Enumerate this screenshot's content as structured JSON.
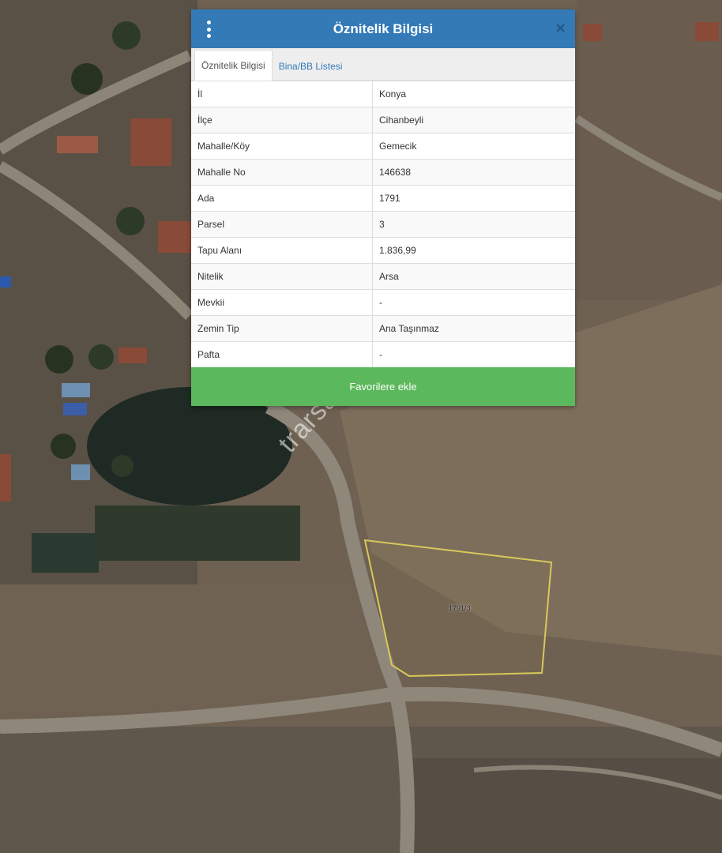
{
  "panel": {
    "title": "Öznitelik Bilgisi",
    "close_glyph": "×",
    "tabs": [
      {
        "label": "Öznitelik Bilgisi",
        "active": true
      },
      {
        "label": "Bina/BB Listesi",
        "active": false
      }
    ],
    "rows": [
      {
        "key": "İl",
        "value": "Konya"
      },
      {
        "key": "İlçe",
        "value": "Cihanbeyli"
      },
      {
        "key": "Mahalle/Köy",
        "value": "Gemecik"
      },
      {
        "key": "Mahalle No",
        "value": "146638"
      },
      {
        "key": "Ada",
        "value": "1791"
      },
      {
        "key": "Parsel",
        "value": "3"
      },
      {
        "key": "Tapu Alanı",
        "value": "1.836,99"
      },
      {
        "key": "Nitelik",
        "value": "Arsa"
      },
      {
        "key": "Mevkii",
        "value": "-"
      },
      {
        "key": "Zemin Tip",
        "value": "Ana Taşınmaz"
      },
      {
        "key": "Pafta",
        "value": "-"
      }
    ],
    "favorite_label": "Favorilere ekle"
  },
  "map": {
    "parcel_label": "1791/3",
    "watermark": "trarsa.com.tr"
  },
  "colors": {
    "header": "#337ab7",
    "favorite": "#5cb85c",
    "parcel_outline": "#d8c85a"
  },
  "icons": {
    "menu": "vertical-dots-icon",
    "close": "close-icon"
  }
}
